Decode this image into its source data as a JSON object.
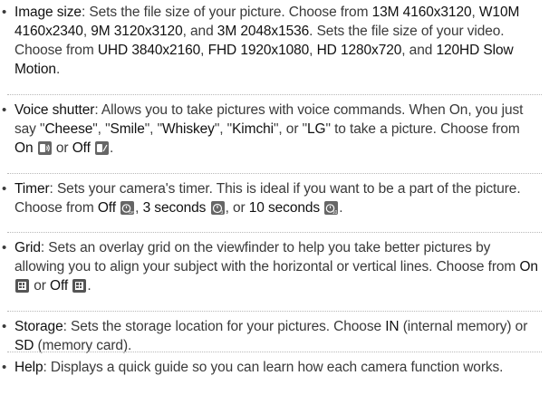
{
  "items": [
    {
      "term": "Image size",
      "parts": [
        ": Sets the file size of your picture. Choose from ",
        "13M 4160x3120",
        ", ",
        "W10M 4160x2340",
        ", ",
        "9M 3120x3120",
        ", and ",
        "3M 2048x1536",
        ". Sets the file size of your video. Choose from ",
        "UHD 3840x2160",
        ", ",
        "FHD 1920x1080",
        ", ",
        "HD 1280x720",
        ", and ",
        "120HD Slow Motion",
        "."
      ]
    },
    {
      "term": "Voice shutter",
      "parts": [
        ": Allows you to take pictures with voice commands. When On, you just say \"",
        "Cheese",
        "\", \"",
        "Smile",
        "\", \"",
        "Whiskey",
        "\", \"",
        "Kimchi",
        "\", or \"",
        "LG",
        "\" to take a picture. Choose from ",
        "On",
        " ",
        " or ",
        "Off",
        " ",
        "."
      ],
      "icons": [
        "voice-shutter-on-icon",
        "voice-shutter-off-icon"
      ]
    },
    {
      "term": "Timer",
      "parts": [
        ": Sets your camera's timer. This is ideal if you want to be a part of the picture. Choose from ",
        "Off",
        " ",
        ", ",
        "3 seconds",
        " ",
        ", or ",
        "10 seconds",
        " ",
        "."
      ],
      "icons": [
        "timer-off-icon",
        "timer-3s-icon",
        "timer-10s-icon"
      ]
    },
    {
      "term": "Grid",
      "parts": [
        ": Sets an overlay grid on the viewfinder to help you take better pictures by allowing you to align your subject with the horizontal or vertical lines. Choose from ",
        "On",
        " ",
        " or ",
        "Off",
        " ",
        "."
      ],
      "icons": [
        "grid-on-icon",
        "grid-off-icon"
      ]
    },
    {
      "term": "Storage",
      "parts": [
        ": Sets the storage location for your pictures. Choose ",
        "IN",
        " (internal memory) or ",
        "SD",
        " (memory card)."
      ]
    },
    {
      "term": "Help",
      "parts": [
        ": Displays a quick guide so you can learn how each camera function works."
      ]
    }
  ]
}
